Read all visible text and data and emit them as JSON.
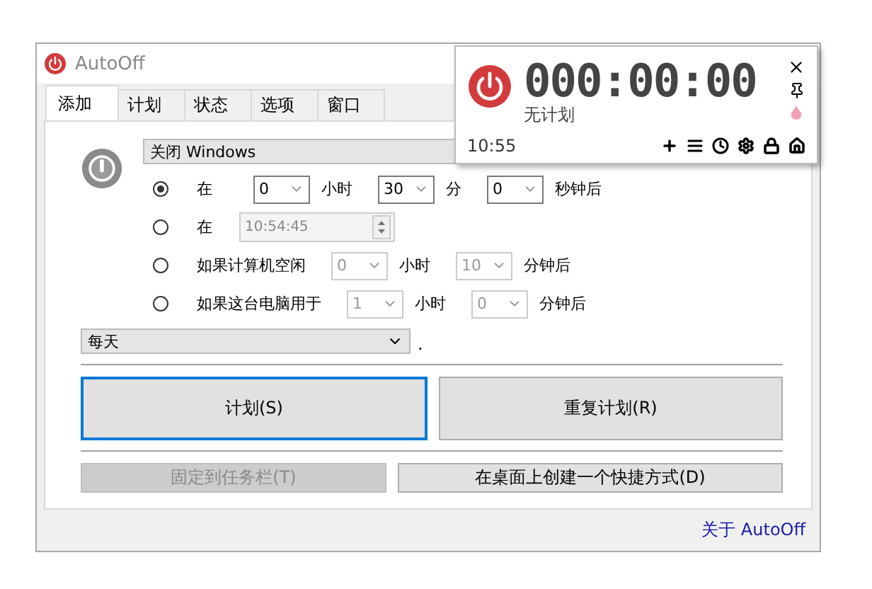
{
  "window": {
    "title": "AutoOff"
  },
  "tabs": [
    {
      "label": "添加",
      "selected": true
    },
    {
      "label": "计划",
      "selected": false
    },
    {
      "label": "状态",
      "selected": false
    },
    {
      "label": "选项",
      "selected": false
    },
    {
      "label": "窗口",
      "selected": false
    }
  ],
  "action": {
    "value": "关闭 Windows"
  },
  "options": [
    {
      "selected": true,
      "parts": [
        {
          "kind": "label",
          "text": "在"
        },
        {
          "kind": "select",
          "value": "0",
          "disabled": false
        },
        {
          "kind": "unit",
          "text": "小时"
        },
        {
          "kind": "select",
          "value": "30",
          "disabled": false
        },
        {
          "kind": "unit",
          "text": "分"
        },
        {
          "kind": "select",
          "value": "0",
          "disabled": false
        },
        {
          "kind": "unit",
          "text": "秒钟后"
        }
      ]
    },
    {
      "selected": false,
      "parts": [
        {
          "kind": "label",
          "text": "在"
        },
        {
          "kind": "time",
          "value": "10:54:45",
          "disabled": true
        }
      ]
    },
    {
      "selected": false,
      "parts": [
        {
          "kind": "label",
          "text": "如果计算机空闲"
        },
        {
          "kind": "select",
          "value": "0",
          "disabled": true
        },
        {
          "kind": "unit",
          "text": "小时"
        },
        {
          "kind": "select",
          "value": "10",
          "disabled": true
        },
        {
          "kind": "unit",
          "text": "分钟后"
        }
      ]
    },
    {
      "selected": false,
      "parts": [
        {
          "kind": "label",
          "text": "如果这台电脑用于"
        },
        {
          "kind": "select",
          "value": "1",
          "disabled": true
        },
        {
          "kind": "unit",
          "text": "小时"
        },
        {
          "kind": "select",
          "value": "0",
          "disabled": true
        },
        {
          "kind": "unit",
          "text": "分钟后"
        }
      ]
    }
  ],
  "repeat": {
    "value": "每天",
    "suffix": "."
  },
  "buttons": [
    {
      "label": "计划(S)",
      "focused": true
    },
    {
      "label": "重复计划(R)",
      "focused": false
    }
  ],
  "small_buttons": [
    {
      "label": "固定到任务栏(T)",
      "disabled": true
    },
    {
      "label": "在桌面上创建一个快捷方式(D)",
      "disabled": false
    }
  ],
  "about_link": "关于 AutoOff",
  "timer_overlay": {
    "countdown": "000:00:00",
    "status": "无计划",
    "clock": "10:55"
  }
}
